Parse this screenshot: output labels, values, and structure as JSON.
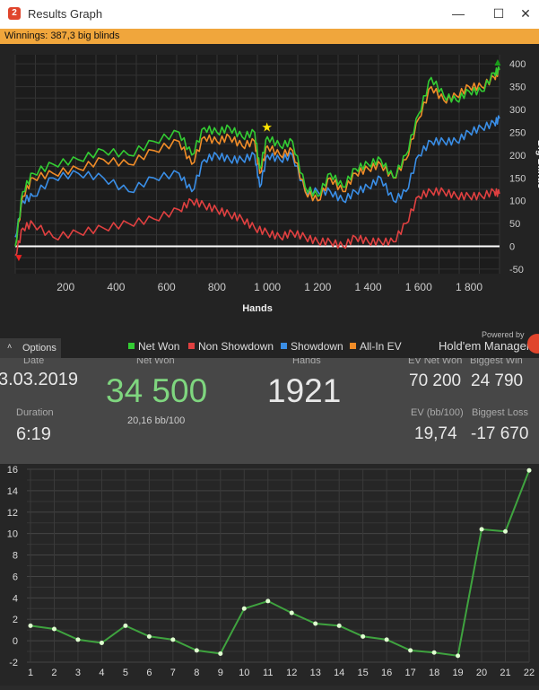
{
  "window": {
    "title": "Results Graph",
    "icon_label": "2",
    "minimize": "—",
    "maximize": "☐",
    "close": "✕"
  },
  "winnings_bar": {
    "text": "Winnings: 387,3 big blinds",
    "color": "#f0a63c"
  },
  "results_graph": {
    "xlabel": "Hands",
    "ylabel": "Big Blinds",
    "x_ticks": [
      "200",
      "400",
      "600",
      "800",
      "1 000",
      "1 200",
      "1 400",
      "1 600",
      "1 800"
    ],
    "y_ticks": [
      "400",
      "350",
      "300",
      "250",
      "200",
      "150",
      "100",
      "50",
      "0",
      "-50"
    ],
    "legend": [
      {
        "label": "Net Won",
        "color": "#33cc33"
      },
      {
        "label": "Non Showdown",
        "color": "#e04040"
      },
      {
        "label": "Showdown",
        "color": "#3a8ee6"
      },
      {
        "label": "All-In EV",
        "color": "#f08c28"
      }
    ],
    "options_label": "Options",
    "powered_by": "Powered by",
    "brand": "Hold'em Manager"
  },
  "stats": {
    "date_label": "Date",
    "date": "3.03.2019",
    "duration_label": "Duration",
    "duration": "6:19",
    "net_won_label": "Net Won",
    "net_won": "34 500",
    "bb100": "20,16 bb/100",
    "hands_label": "Hands",
    "hands": "1921",
    "ev_net_won_label": "EV Net Won",
    "ev_net_won": "70 200",
    "ev_bb100_label": "EV (bb/100)",
    "ev_bb100": "19,74",
    "biggest_win_label": "Biggest Win",
    "biggest_win": "24 790",
    "biggest_loss_label": "Biggest Loss",
    "biggest_loss": "-17 670"
  },
  "chart_data": [
    {
      "type": "line",
      "xlabel": "Hands",
      "ylabel": "Big Blinds",
      "xlim": [
        0,
        1921
      ],
      "ylim": [
        -60,
        420
      ],
      "grid": true,
      "legend_position": "bottom",
      "series": [
        {
          "name": "Net Won",
          "color": "#33cc33",
          "x": [
            0,
            30,
            70,
            150,
            250,
            350,
            450,
            550,
            650,
            700,
            750,
            800,
            850,
            900,
            950,
            970,
            1000,
            1050,
            1100,
            1150,
            1200,
            1250,
            1300,
            1350,
            1400,
            1450,
            1500,
            1550,
            1600,
            1650,
            1700,
            1750,
            1800,
            1850,
            1900,
            1921
          ],
          "y": [
            0,
            120,
            160,
            180,
            190,
            210,
            200,
            230,
            250,
            200,
            260,
            250,
            260,
            240,
            250,
            170,
            240,
            220,
            230,
            130,
            110,
            160,
            130,
            170,
            180,
            190,
            150,
            200,
            290,
            370,
            330,
            320,
            340,
            340,
            380,
            387
          ]
        },
        {
          "name": "Non Showdown",
          "color": "#e04040",
          "x": [
            0,
            30,
            70,
            150,
            250,
            350,
            450,
            550,
            650,
            700,
            750,
            800,
            850,
            900,
            950,
            1000,
            1050,
            1100,
            1150,
            1200,
            1250,
            1300,
            1350,
            1400,
            1450,
            1500,
            1550,
            1600,
            1650,
            1700,
            1750,
            1800,
            1850,
            1900,
            1921
          ],
          "y": [
            -20,
            40,
            50,
            20,
            30,
            40,
            50,
            60,
            80,
            100,
            90,
            80,
            70,
            60,
            40,
            30,
            20,
            30,
            20,
            10,
            10,
            0,
            20,
            10,
            10,
            10,
            50,
            110,
            120,
            120,
            110,
            110,
            110,
            120,
            115
          ]
        },
        {
          "name": "Showdown",
          "color": "#3a8ee6",
          "x": [
            0,
            30,
            70,
            150,
            250,
            350,
            450,
            550,
            650,
            700,
            750,
            800,
            850,
            900,
            950,
            970,
            1000,
            1050,
            1100,
            1150,
            1200,
            1250,
            1300,
            1350,
            1400,
            1450,
            1500,
            1550,
            1600,
            1650,
            1700,
            1750,
            1800,
            1850,
            1900,
            1921
          ],
          "y": [
            20,
            100,
            110,
            150,
            160,
            150,
            120,
            150,
            160,
            120,
            190,
            200,
            190,
            190,
            200,
            130,
            200,
            190,
            200,
            120,
            120,
            120,
            100,
            120,
            130,
            150,
            100,
            120,
            200,
            230,
            230,
            230,
            250,
            260,
            270,
            280
          ]
        },
        {
          "name": "All-In EV",
          "color": "#f08c28",
          "x": [
            0,
            30,
            70,
            150,
            250,
            350,
            450,
            550,
            650,
            700,
            750,
            800,
            850,
            900,
            950,
            970,
            1000,
            1050,
            1100,
            1150,
            1200,
            1250,
            1300,
            1350,
            1400,
            1450,
            1500,
            1550,
            1600,
            1650,
            1700,
            1750,
            1800,
            1850,
            1900,
            1921
          ],
          "y": [
            0,
            110,
            150,
            160,
            170,
            190,
            180,
            210,
            230,
            180,
            240,
            230,
            240,
            220,
            230,
            160,
            220,
            200,
            210,
            120,
            100,
            150,
            120,
            160,
            170,
            180,
            150,
            190,
            280,
            350,
            320,
            330,
            350,
            350,
            370,
            387
          ]
        }
      ]
    },
    {
      "type": "line",
      "x": [
        1,
        2,
        3,
        4,
        5,
        6,
        7,
        8,
        9,
        10,
        11,
        12,
        13,
        14,
        15,
        16,
        17,
        18,
        19,
        20,
        21,
        22
      ],
      "series": [
        {
          "values": [
            1.4,
            1.1,
            0.1,
            -0.2,
            1.4,
            0.4,
            0.1,
            -0.9,
            -1.2,
            3.0,
            3.7,
            2.6,
            1.6,
            1.4,
            0.4,
            0.1,
            -0.9,
            -1.1,
            -1.4,
            10.4,
            10.2,
            15.9
          ]
        }
      ],
      "ylim": [
        -2,
        16
      ],
      "xlim": [
        1,
        22
      ],
      "grid": true
    }
  ]
}
